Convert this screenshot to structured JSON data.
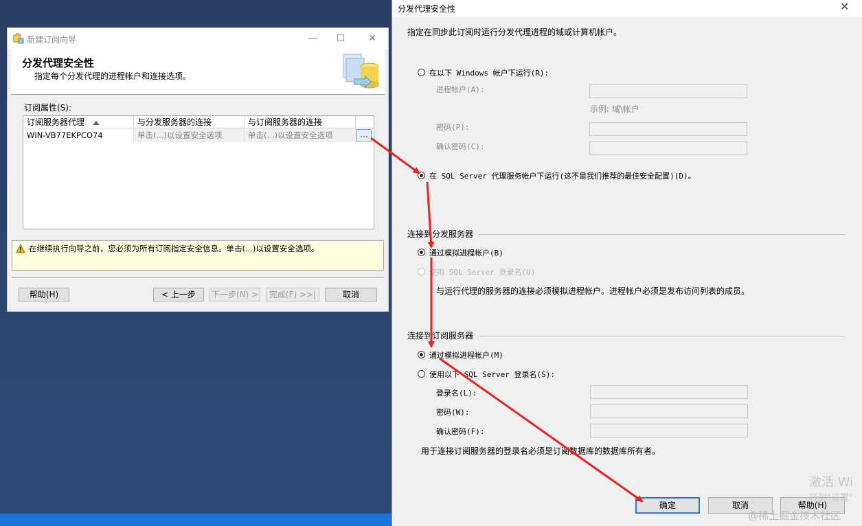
{
  "left_window": {
    "title": "新建订阅向导",
    "header_title": "分发代理安全性",
    "header_subtitle": "指定每个分发代理的进程帐户和连接选项。",
    "props_label": "订阅属性(S):",
    "columns": [
      "订阅服务器代理",
      "与分发服务器的连接",
      "与订阅服务器的连接"
    ],
    "row": {
      "agent": "WIN-VB77EKPCO74",
      "dist_conn": "单击(...)以设置安全选项",
      "sub_conn": "单击(...)以设置安全选项"
    },
    "ellipsis_label": "...",
    "warning": "在继续执行向导之前，您必须为所有订阅指定安全信息。单击(...)以设置安全选项。",
    "buttons": {
      "help": "帮助(H)",
      "back": "< 上一步",
      "next": "下一步(N) >",
      "finish": "完成(F) >>|",
      "cancel": "取消"
    },
    "controls": {
      "minimize": "—",
      "maximize": "☐",
      "close": "✕"
    }
  },
  "right_window": {
    "title": "分发代理安全性",
    "close": "✕",
    "intro": "指定在同步此订阅时运行分发代理进程的域或计算机帐户。",
    "run_windows": "在以下 Windows 帐户下运行(R):",
    "process_account_label": "进程帐户(A):",
    "example": "示例: 域\\帐户",
    "password_label": "密码(P):",
    "confirm_password_label": "确认密码(C):",
    "run_sqlagent": "在 SQL Server 代理服务帐户下运行(这不是我们推荐的最佳安全配置)(D)。",
    "dist_group": "连接到分发服务器",
    "dist_impersonate": "通过模拟进程帐户(B)",
    "dist_sql_login": "使用 SQL Server 登录名(U)",
    "dist_note": "与运行代理的服务器的连接必须模拟进程帐户。进程帐户必须是发布访问列表的成员。",
    "sub_group": "连接到订阅服务器",
    "sub_impersonate": "通过模拟进程帐户(M)",
    "sub_sql_login": "使用以下 SQL Server 登录名(S):",
    "login_label": "登录名(L):",
    "sub_password_label": "密码(W):",
    "sub_confirm_label": "确认密码(F):",
    "sub_note": "用于连接订阅服务器的登录名必须是订阅数据库的数据库所有者。",
    "buttons": {
      "ok": "确定",
      "cancel": "取消",
      "help": "帮助(H)"
    }
  },
  "watermarks": {
    "activate": "激活 Wi",
    "settings": "转到\"设置\"",
    "site": "@稀土掘金技术社区"
  },
  "colors": {
    "annotation_arrow": "#e8231f",
    "default_button_border": "#2f74d0",
    "desktop": "#2c4670",
    "taskbar": "#1a73d9"
  }
}
